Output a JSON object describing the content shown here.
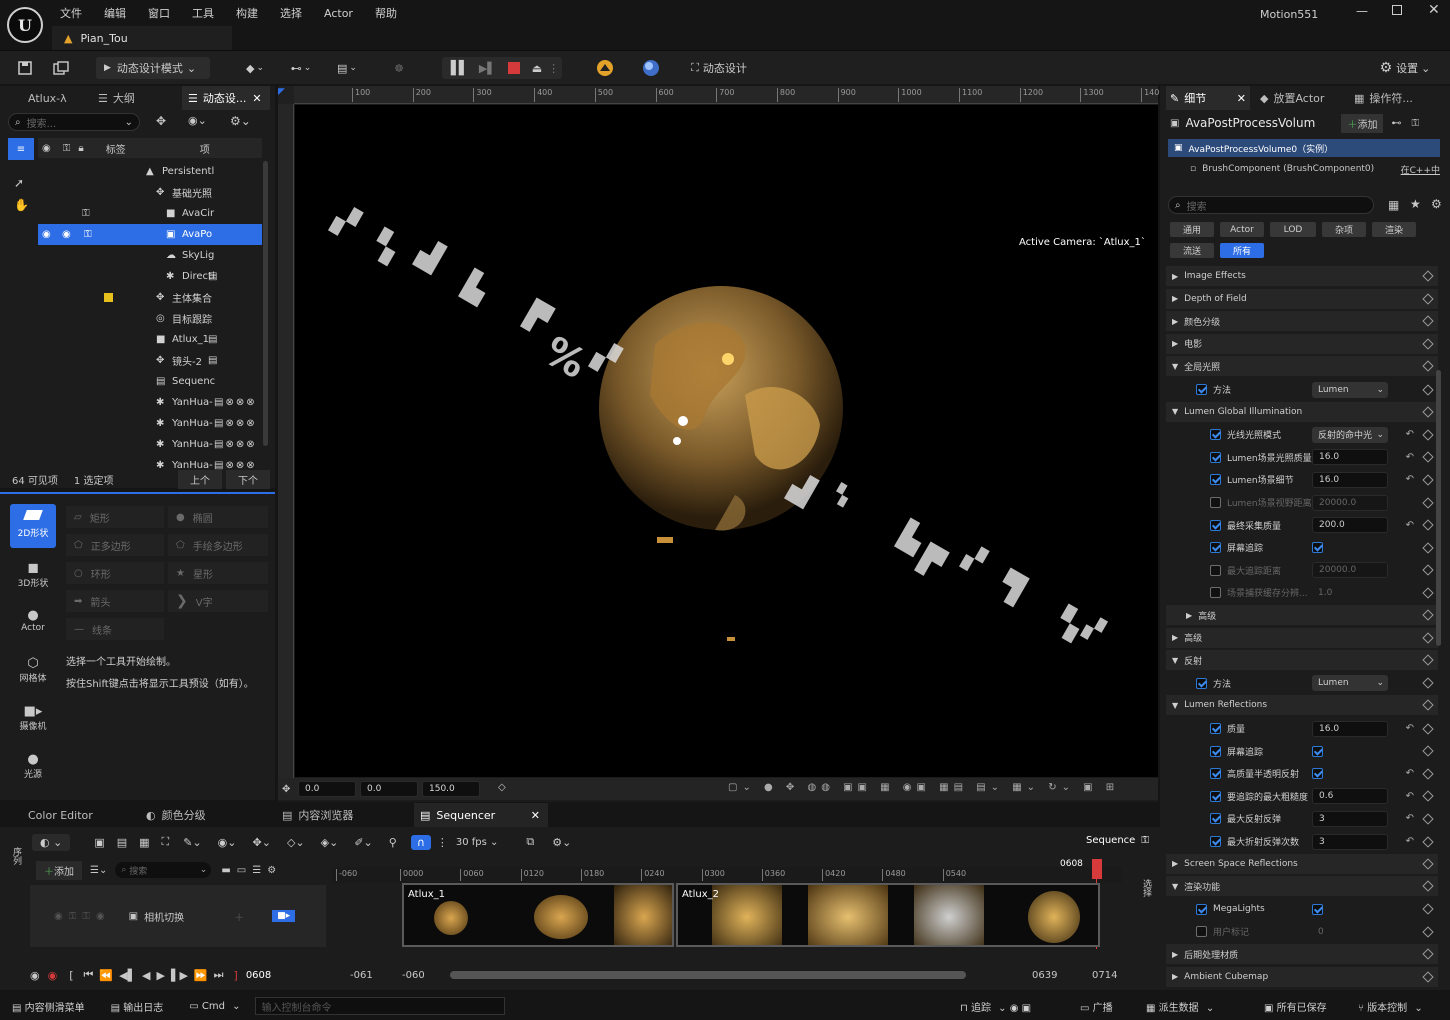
{
  "app": {
    "project_title": "Motion551",
    "level_tab": "Pian_Tou",
    "menu": [
      "文件",
      "编辑",
      "窗口",
      "工具",
      "构建",
      "选择",
      "Actor",
      "帮助"
    ]
  },
  "toolbar": {
    "mode_label": "动态设计模式",
    "motion_design_label": "动态设计",
    "settings_label": "设置"
  },
  "outliner": {
    "tabs": [
      "Atlux-λ",
      "大纲",
      "动态设..."
    ],
    "search_placeholder": "搜索...",
    "col_label": "标签",
    "col_item": "项",
    "rows": [
      {
        "label": "Persistentl",
        "indent": 0
      },
      {
        "label": "基础光照",
        "indent": 1
      },
      {
        "label": "AvaCir",
        "indent": 2
      },
      {
        "label": "AvaPo",
        "indent": 2
      },
      {
        "label": "SkyLig",
        "indent": 2
      },
      {
        "label": "Directi",
        "indent": 2
      },
      {
        "label": "主体集合",
        "indent": 1
      },
      {
        "label": "目标跟踪",
        "indent": 1
      },
      {
        "label": "Atlux_1",
        "indent": 1
      },
      {
        "label": "镜头-2 ",
        "indent": 1
      },
      {
        "label": "Sequenc",
        "indent": 1
      },
      {
        "label": "YanHua-",
        "indent": 1
      },
      {
        "label": "YanHua-",
        "indent": 1
      },
      {
        "label": "YanHua-",
        "indent": 1
      },
      {
        "label": "YanHua-",
        "indent": 1
      }
    ],
    "visible_count": "64 可见项",
    "selected_count": "1 选定项",
    "prev": "上个",
    "next": "下个"
  },
  "shapes_panel": {
    "categories": [
      "2D形状",
      "3D形状",
      "Actor",
      "网格体",
      "摄像机",
      "光源"
    ],
    "tools": [
      "矩形",
      "椭圆",
      "正多边形",
      "手绘多边形",
      "环形",
      "星形",
      "箭头",
      "V字",
      "线条"
    ],
    "hint1": "选择一个工具开始绘制。",
    "hint2": "按住Shift键点击将显示工具预设（如有）。"
  },
  "viewport": {
    "camera_label": "Active Camera: `Atlux_1`",
    "ruler_ticks": [
      "100",
      "200",
      "300",
      "400",
      "500",
      "600",
      "700",
      "800",
      "900",
      "1000",
      "1100",
      "1200",
      "1300",
      "1400"
    ],
    "field1": "0.0",
    "field2": "0.0",
    "field3": "150.0"
  },
  "details": {
    "tabs": [
      "细节",
      "放置Actor",
      "操作符..."
    ],
    "actor_name": "AvaPostProcessVolum",
    "add_label": "添加",
    "instance_label": "AvaPostProcessVolume0（实例）",
    "component_label": "BrushComponent (BrushComponent0)",
    "cpp_link": "在C++中",
    "search_placeholder": "搜索",
    "filters_row1": [
      "通用",
      "Actor",
      "LOD",
      "杂项",
      "渲染"
    ],
    "filters_row2": [
      "流送",
      "所有"
    ],
    "sections": [
      {
        "type": "sec",
        "label": "Image Effects",
        "level": 0,
        "open": false
      },
      {
        "type": "sec",
        "label": "Depth of Field",
        "level": 0,
        "open": false
      },
      {
        "type": "sec",
        "label": "颜色分级",
        "level": 0,
        "open": false
      },
      {
        "type": "sec",
        "label": "电影",
        "level": 0,
        "open": false
      },
      {
        "type": "sec",
        "label": "全局光照",
        "level": 0,
        "open": true
      },
      {
        "type": "prop",
        "label": "方法",
        "checked": true,
        "kind": "dropdown",
        "value": "Lumen",
        "level": 1
      },
      {
        "type": "sec",
        "label": "Lumen Global Illumination",
        "level": 0,
        "open": true
      },
      {
        "type": "prop",
        "label": "光线光照模式",
        "checked": true,
        "kind": "dropdown",
        "value": "反射的命中光",
        "level": 2,
        "undo": true
      },
      {
        "type": "prop",
        "label": "Lumen场景光照质量",
        "checked": true,
        "kind": "num",
        "value": "16.0",
        "level": 2,
        "undo": true
      },
      {
        "type": "prop",
        "label": "Lumen场景细节",
        "checked": true,
        "kind": "num",
        "value": "16.0",
        "level": 2,
        "undo": true
      },
      {
        "type": "prop",
        "label": "Lumen场景视野距离",
        "checked": false,
        "kind": "num",
        "value": "20000.0",
        "level": 2,
        "dim": true
      },
      {
        "type": "prop",
        "label": "最终采集质量",
        "checked": true,
        "kind": "num",
        "value": "200.0",
        "level": 2,
        "undo": true
      },
      {
        "type": "prop",
        "label": "屏幕追踪",
        "checked": true,
        "kind": "check",
        "value": "",
        "level": 2
      },
      {
        "type": "prop",
        "label": "最大追踪距离",
        "checked": false,
        "kind": "num",
        "value": "20000.0",
        "level": 2,
        "dim": true
      },
      {
        "type": "prop",
        "label": "场景捕获缓存分辨...",
        "checked": false,
        "kind": "plain",
        "value": "1.0",
        "level": 2,
        "dim": true
      },
      {
        "type": "sec",
        "label": "高级",
        "level": 1,
        "open": false
      },
      {
        "type": "sec",
        "label": "高级",
        "level": 0,
        "open": false
      },
      {
        "type": "sec",
        "label": "反射",
        "level": 0,
        "open": true
      },
      {
        "type": "prop",
        "label": "方法",
        "checked": true,
        "kind": "dropdown",
        "value": "Lumen",
        "level": 1
      },
      {
        "type": "sec",
        "label": "Lumen Reflections",
        "level": 0,
        "open": true
      },
      {
        "type": "prop",
        "label": "质量",
        "checked": true,
        "kind": "num",
        "value": "16.0",
        "level": 2,
        "undo": true
      },
      {
        "type": "prop",
        "label": "屏幕追踪",
        "checked": true,
        "kind": "check",
        "value": "",
        "level": 2
      },
      {
        "type": "prop",
        "label": "高质量半透明反射",
        "checked": true,
        "kind": "check",
        "value": "",
        "level": 2,
        "undo": true
      },
      {
        "type": "prop",
        "label": "要追踪的最大粗糙度",
        "checked": true,
        "kind": "num",
        "value": "0.6",
        "level": 2,
        "undo": true
      },
      {
        "type": "prop",
        "label": "最大反射反弹",
        "checked": true,
        "kind": "num",
        "value": "3",
        "level": 2,
        "undo": true
      },
      {
        "type": "prop",
        "label": "最大折射反弹次数",
        "checked": true,
        "kind": "num",
        "value": "3",
        "level": 2,
        "undo": true
      },
      {
        "type": "sec",
        "label": "Screen Space Reflections",
        "level": 0,
        "open": false
      },
      {
        "type": "sec",
        "label": "渲染功能",
        "level": 0,
        "open": true
      },
      {
        "type": "prop",
        "label": "MegaLights",
        "checked": true,
        "kind": "check",
        "value": "",
        "level": 1
      },
      {
        "type": "prop",
        "label": "用户标记",
        "checked": false,
        "kind": "plain",
        "value": "0",
        "level": 1,
        "dim": true
      },
      {
        "type": "sec",
        "label": "后期处理材质",
        "level": 0,
        "open": false
      },
      {
        "type": "sec",
        "label": "Ambient Cubemap",
        "level": 0,
        "open": false
      }
    ]
  },
  "bottom_tabs": [
    "Color Editor",
    "颜色分级",
    "内容浏览器",
    "Sequencer"
  ],
  "sequencer": {
    "add_label": "添加",
    "search_placeholder": "搜索",
    "fps_label": "30 fps",
    "sequence_label": "Sequence",
    "track_label": "相机切换",
    "clip1_label": "Atlux_1",
    "clip2_label": "Atlux_2",
    "ruler": [
      "-060",
      "0000",
      "0060",
      "0120",
      "0180",
      "0240",
      "0300",
      "0360",
      "0420",
      "0480",
      "0540"
    ],
    "playhead": "0608",
    "current_frame": "0608",
    "start_in": "-061",
    "start_view": "-060",
    "end_view": "0639",
    "end_out": "0714",
    "side_label_left": "序列",
    "side_label_right": "选择"
  },
  "statusbar": {
    "content_drawer": "内容侧滑菜单",
    "output_log": "输出日志",
    "cmd": "Cmd",
    "console_placeholder": "输入控制台命令",
    "trace": "追踪",
    "broadcast": "广播",
    "derived_data": "派生数据",
    "all_saved": "所有已保存",
    "version_control": "版本控制"
  }
}
